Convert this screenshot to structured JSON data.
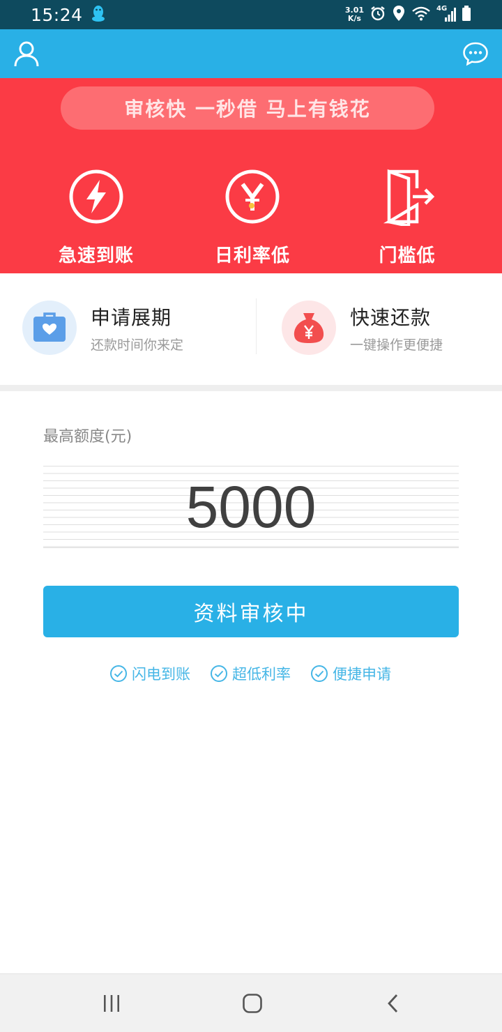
{
  "status_bar": {
    "time": "15:24",
    "net_speed_value": "3.01",
    "net_speed_unit": "K/s",
    "network_type": "4G"
  },
  "header": {
    "user_icon": "user-icon",
    "message_icon": "message-icon"
  },
  "banner": {
    "slogan": "审核快  一秒借 马上有钱花",
    "features": [
      {
        "label": "急速到账",
        "icon": "lightning-icon"
      },
      {
        "label": "日利率低",
        "icon": "yuan-icon"
      },
      {
        "label": "门槛低",
        "icon": "door-icon"
      }
    ]
  },
  "services": [
    {
      "title": "申请展期",
      "subtitle": "还款时间你来定",
      "icon": "briefcase-heart-icon"
    },
    {
      "title": "快速还款",
      "subtitle": "一键操作更便捷",
      "icon": "money-bag-icon"
    }
  ],
  "quota": {
    "label": "最高额度(元)",
    "value": "5000"
  },
  "main_button": {
    "label": "资料审核中"
  },
  "tags": [
    "闪电到账",
    "超低利率",
    "便捷申请"
  ],
  "colors": {
    "status_bar": "#0e4a5e",
    "primary": "#29b0e6",
    "banner": "#fb3b45",
    "tag_text": "#45b6e6"
  }
}
